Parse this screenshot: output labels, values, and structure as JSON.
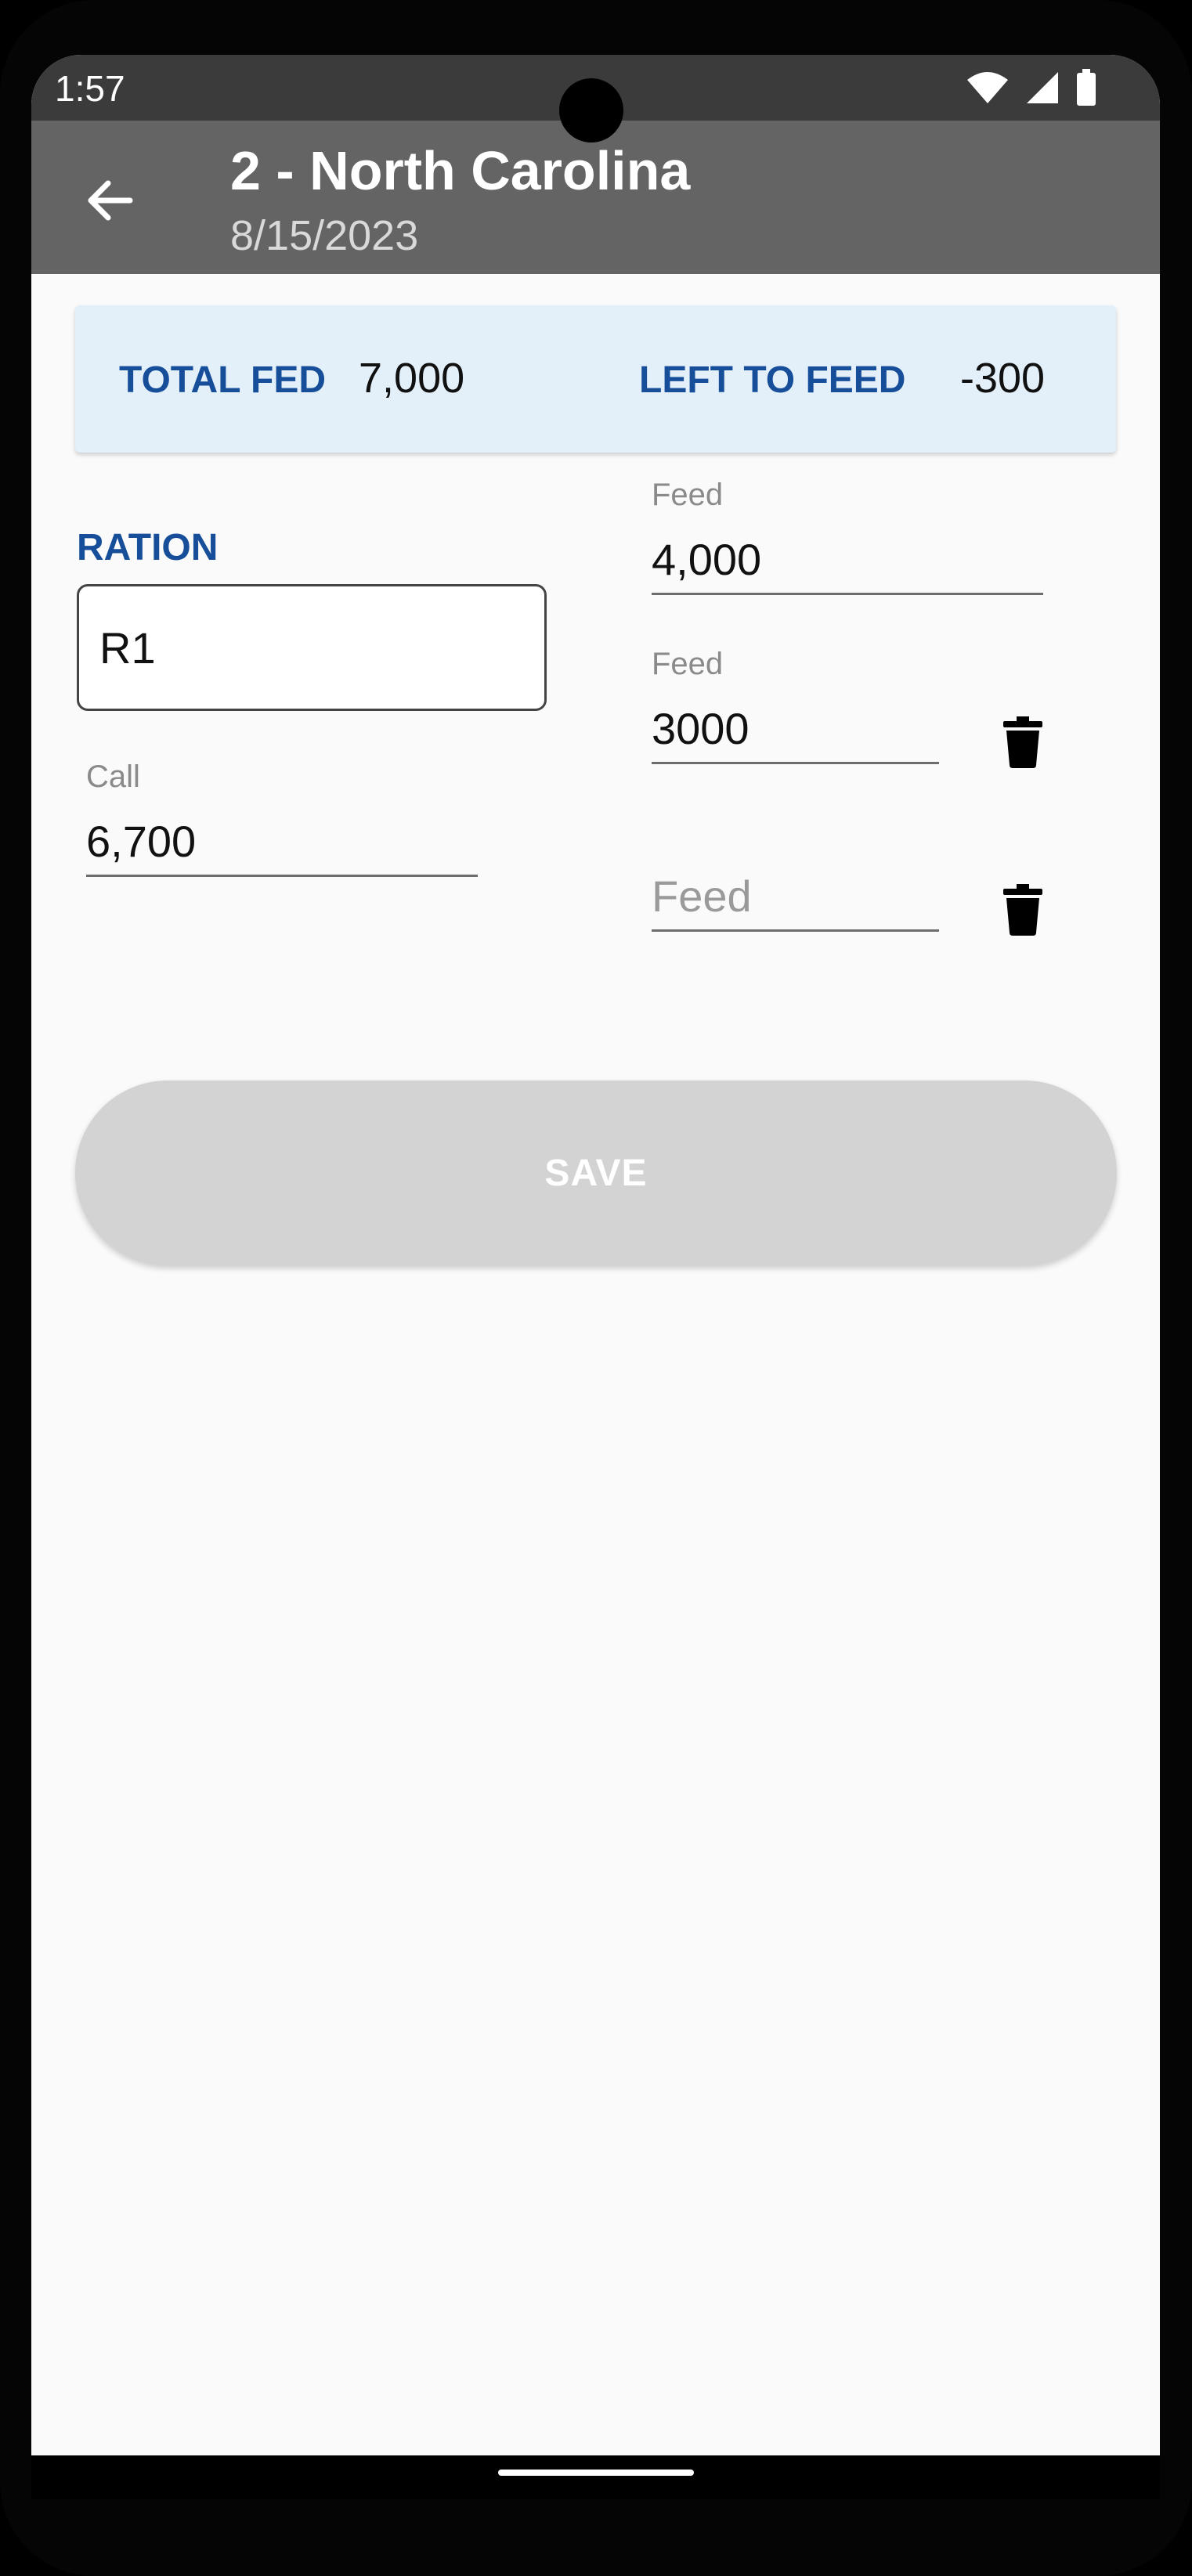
{
  "status": {
    "time": "1:57",
    "icons": [
      "wifi-icon",
      "signal-icon",
      "battery-icon"
    ]
  },
  "appbar": {
    "title": "2 - North Carolina",
    "subtitle": "8/15/2023",
    "back_icon": "arrow-left-icon"
  },
  "summary": {
    "total_fed_label": "TOTAL FED",
    "total_fed_value": "7,000",
    "left_to_feed_label": "LEFT TO FEED",
    "left_to_feed_value": "-300"
  },
  "form": {
    "ration_label": "RATION",
    "ration_value": "R1",
    "call_label": "Call",
    "call_value": "6,700",
    "feeds": [
      {
        "label": "Feed",
        "value": "4,000",
        "placeholder": "Feed",
        "deletable": false
      },
      {
        "label": "Feed",
        "value": "3000",
        "placeholder": "Feed",
        "deletable": true
      },
      {
        "label": "",
        "value": "",
        "placeholder": "Feed",
        "deletable": true
      }
    ]
  },
  "actions": {
    "save_label": "SAVE"
  },
  "colors": {
    "accent": "#174e9a",
    "appbar": "#646464",
    "summary_bg": "#e3f0fa",
    "save_disabled": "#d3d3d3"
  }
}
